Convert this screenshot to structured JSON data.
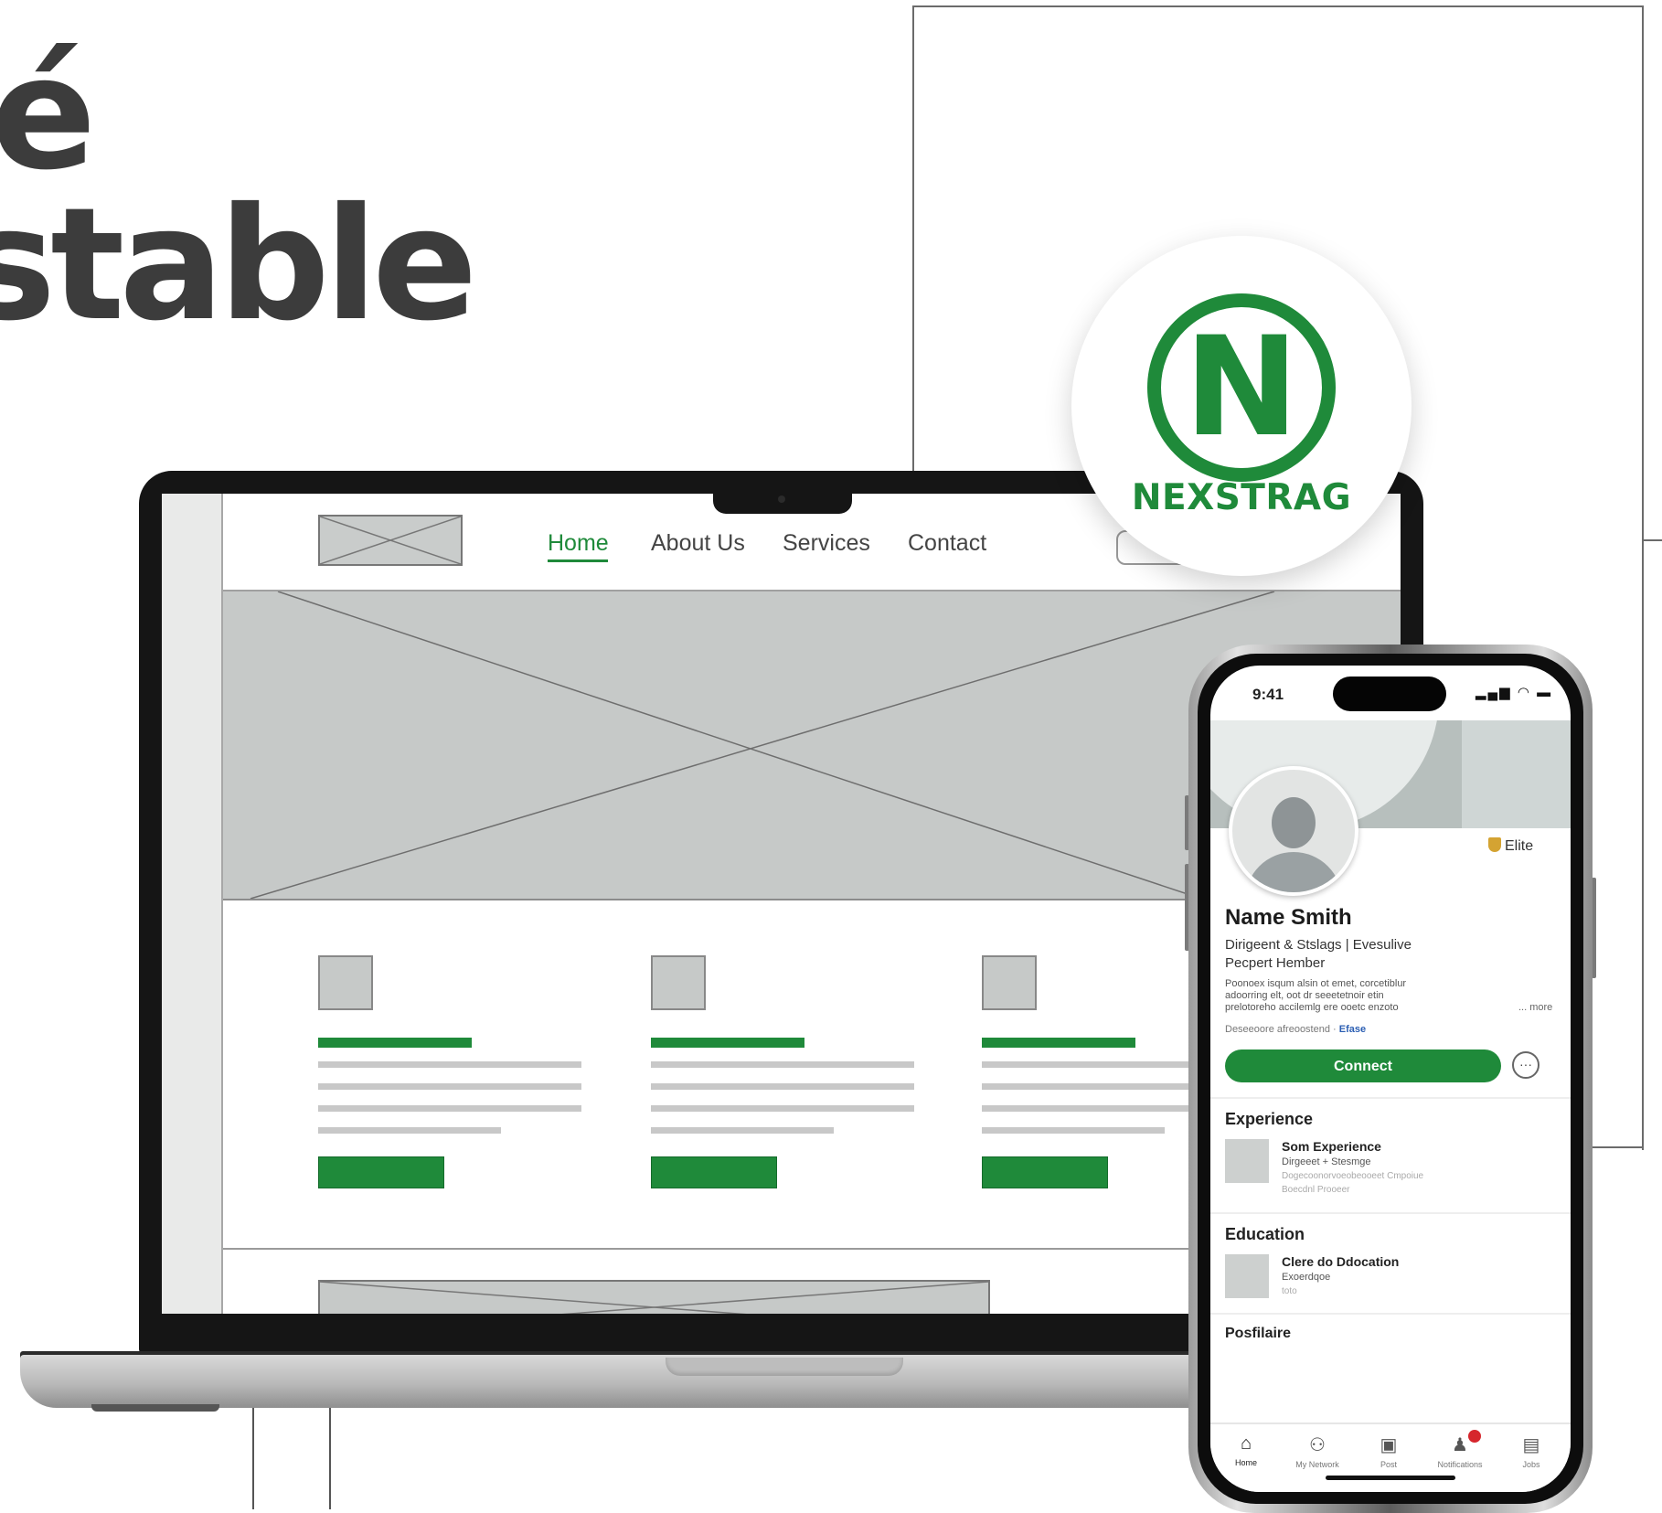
{
  "headline": {
    "line1": "é",
    "line2": "stable"
  },
  "brand": {
    "name": "NEXSTRAG",
    "letter": "N",
    "accent": "#1f8a3a"
  },
  "website": {
    "nav": [
      {
        "label": "Home",
        "active": true
      },
      {
        "label": "About Us",
        "active": false
      },
      {
        "label": "Services",
        "active": false
      },
      {
        "label": "Contact",
        "active": false
      }
    ]
  },
  "phone": {
    "status_time": "9:41",
    "status_icons": "▂▄▆ ◠ ▬",
    "badge": "Elite",
    "name": "Name Smith",
    "headline_1": "Dirigeent & Stslags | Evesulive",
    "headline_2": "Pecpert Hember",
    "about_1": "Poonoex isqum alsin ot emet, corcetiblur",
    "about_2": "adoorring elt, oot dr seeetetnoir etin",
    "about_3": "prelotoreho accilemlg ere ooetc enzoto",
    "more": "... more",
    "contact_prefix": "Deseeoore afreoostend ·",
    "contact_link": "Efase",
    "connect_label": "Connect",
    "more_button": "···",
    "experience": {
      "title": "Experience",
      "item_title": "Som Experience",
      "item_sub": "Dirgeeet + Stesmge",
      "item_faint_1": "Dogecoonorvoeobeooeet Cmpoiue",
      "item_faint_2": "Boecdnl Prooeer"
    },
    "education": {
      "title": "Education",
      "item_title": "Clere do Ddocation",
      "item_sub": "Exoerdqoe",
      "item_faint_1": "toto"
    },
    "section3_title": "Posfilaire",
    "tabs": [
      {
        "icon": "⌂",
        "label": "Home",
        "active": true
      },
      {
        "icon": "⚇",
        "label": "My Network",
        "active": false
      },
      {
        "icon": "▣",
        "label": "Post",
        "active": false
      },
      {
        "icon": "♟",
        "label": "Notifications",
        "active": false
      },
      {
        "icon": "▤",
        "label": "Jobs",
        "active": false
      }
    ]
  }
}
